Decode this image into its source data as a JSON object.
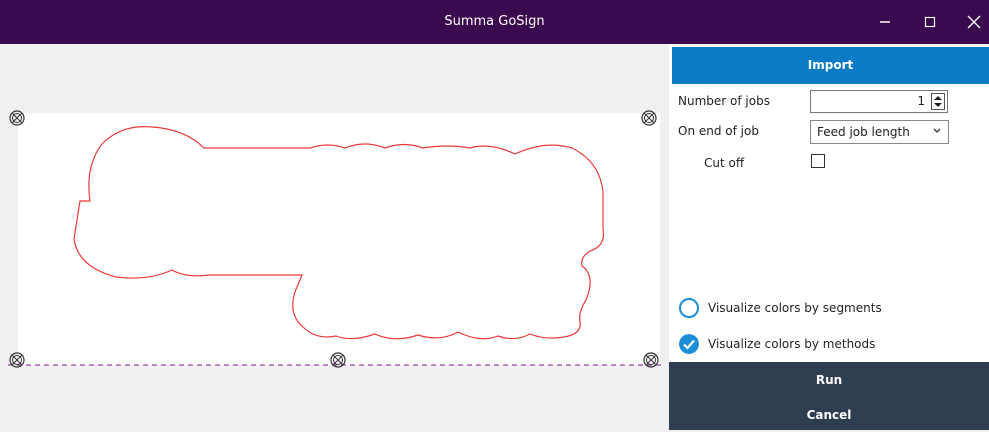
{
  "window": {
    "title": "Summa GoSign",
    "icons": {
      "minimize": "minimize-icon",
      "maximize": "maximize-icon",
      "close": "close-icon"
    },
    "title_bar_color": "#3b0a4e"
  },
  "preview": {
    "icons": {
      "registration_mark": "registration-mark-icon"
    },
    "outline_color": "#ec3a3a",
    "baseline_color": "#7a1a8a"
  },
  "panel": {
    "import_label": "Import",
    "accent_color": "#0a7bc4",
    "number_of_jobs": {
      "label": "Number of jobs",
      "value": "1"
    },
    "on_end_of_job": {
      "label": "On end of job",
      "selected": "Feed job length"
    },
    "cut_off": {
      "label": "Cut off",
      "checked": false
    },
    "visualize_segments": {
      "label": "Visualize colors by segments",
      "selected": false
    },
    "visualize_methods": {
      "label": "Visualize colors by methods",
      "selected": true
    },
    "run_label": "Run",
    "cancel_label": "Cancel",
    "footer_color": "#2d3e50"
  }
}
